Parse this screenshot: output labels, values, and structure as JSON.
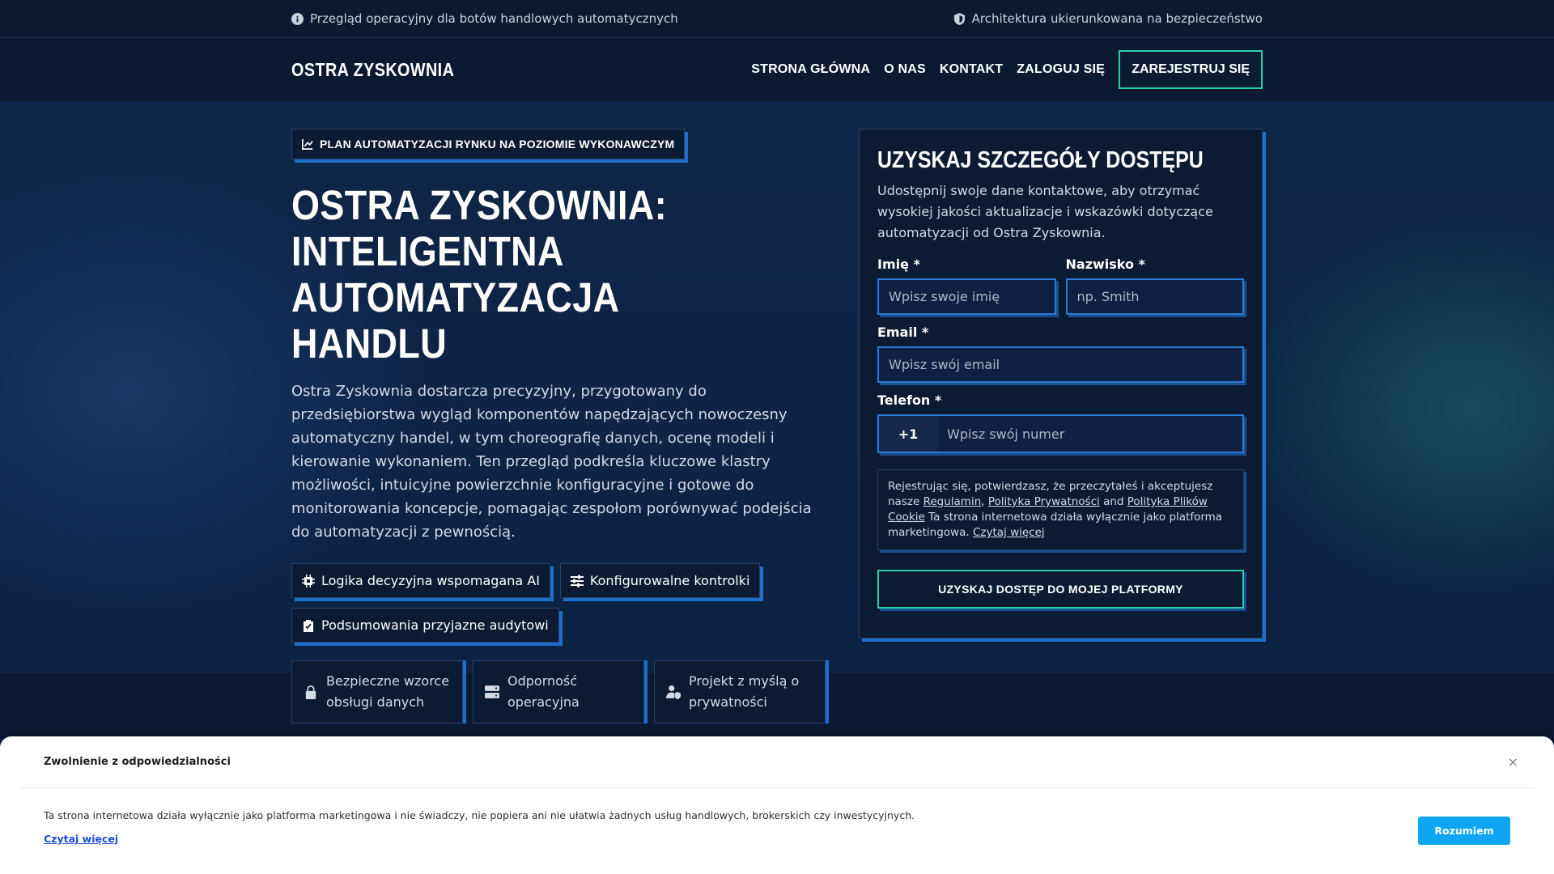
{
  "topbar": {
    "left_text": "Przegląd operacyjny dla botów handlowych automatycznych",
    "right_text": "Architektura ukierunkowana na bezpieczeństwo"
  },
  "header": {
    "brand": "OSTRA ZYSKOWNIA",
    "nav": [
      "STRONA GŁÓWNA",
      "O NAS",
      "KONTAKT",
      "ZALOGUJ SIĘ"
    ],
    "cta": "ZAREJESTRUJ SIĘ"
  },
  "hero": {
    "eyebrow": "PLAN AUTOMATYZACJI RYNKU NA POZIOMIE WYKONAWCZYM",
    "title_line1": "OSTRA ZYSKOWNIA:",
    "title_line2": "INTELIGENTNA AUTOMATYZACJA",
    "title_line3": "HANDLU",
    "description": "Ostra Zyskownia dostarcza precyzyjny, przygotowany do przedsiębiorstwa wygląd komponentów napędzających nowoczesny automatyczny handel, w tym choreografię danych, ocenę modeli i kierowanie wykonaniem. Ten przegląd podkreśla kluczowe klastry możliwości, intuicyjne powierzchnie konfiguracyjne i gotowe do monitorowania koncepcje, pomagając zespołom porównywać podejścia do automatyzacji z pewnością.",
    "chips": [
      "Logika decyzyjna wspomagana AI",
      "Konfigurowalne kontrolki",
      "Podsumowania przyjazne audytowi"
    ],
    "trust": [
      "Bezpieczne wzorce obsługi danych",
      "Odporność operacyjna",
      "Projekt z myślą o prywatności"
    ]
  },
  "form": {
    "title": "UZYSKAJ SZCZEGÓŁY DOSTĘPU",
    "description": "Udostępnij swoje dane kontaktowe, aby otrzymać wysokiej jakości aktualizacje i wskazówki dotyczące automatyzacji od Ostra Zyskownia.",
    "first_name_label": "Imię *",
    "first_name_placeholder": "Wpisz swoje imię",
    "last_name_label": "Nazwisko *",
    "last_name_placeholder": "np. Smith",
    "email_label": "Email *",
    "email_placeholder": "Wpisz swój email",
    "phone_label": "Telefon *",
    "phone_code": "+1",
    "phone_placeholder": "Wpisz swój numer",
    "terms_prefix": "Rejestrując się, potwierdzasz, że przeczytałeś i akceptujesz nasze",
    "terms_link": "Regulamin",
    "privacy_link": "Polityka Prywatności",
    "and_text": "and",
    "cookie_link": "Polityka Plików Cookie",
    "terms_suffix": "Ta strona internetowa działa wyłącznie jako platforma marketingowa.",
    "read_more": "Czytaj więcej",
    "submit": "UZYSKAJ DOSTĘP DO MOJEJ PLATFORMY"
  },
  "disclaimer": {
    "title": "Zwolnienie z odpowiedzialności",
    "close": "×",
    "text": "Ta strona internetowa działa wyłącznie jako platforma marketingowa i nie świadczy, nie popiera ani nie ułatwia żadnych usług handlowych, brokerskich czy inwestycyjnych.",
    "read_more": "Czytaj więcej",
    "button": "Rozumiem"
  },
  "colors": {
    "accent_green": "#2bd1a5",
    "accent_blue": "#1e6fc9",
    "cta_button": "#0ea5f3"
  }
}
